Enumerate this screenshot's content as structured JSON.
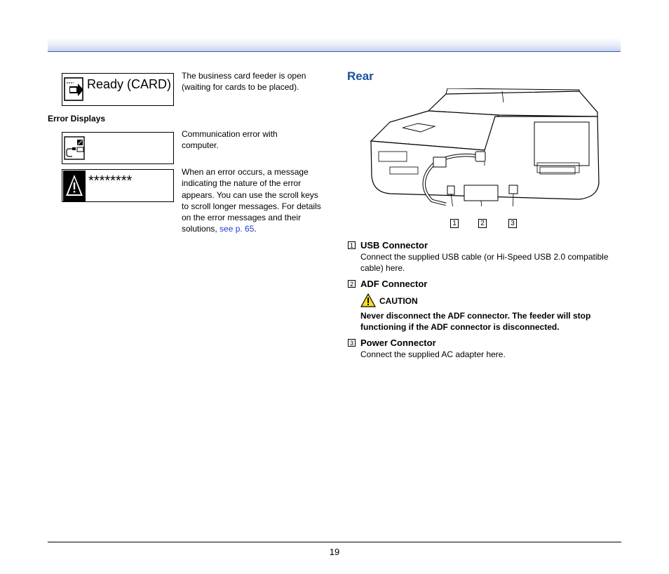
{
  "ready_card": {
    "lcd_text": "Ready (CARD)",
    "description": "The business card feeder is open (waiting for cards to be placed)."
  },
  "error_displays": {
    "heading": "Error Displays",
    "comm_error": {
      "description": "Communication error with computer."
    },
    "error_message": {
      "lcd_text": "********",
      "description": "When an error occurs, a message indicating the nature of the error appears. You can use the scroll keys to scroll longer messages. For details on the error messages and their solutions, ",
      "link_text": "see p. 65",
      "trailing": "."
    }
  },
  "rear": {
    "title": "Rear",
    "callouts": [
      "1",
      "2",
      "3"
    ],
    "items": [
      {
        "num": "1",
        "title": "USB Connector",
        "text": "Connect the supplied USB cable (or Hi-Speed USB 2.0 compatible cable) here."
      },
      {
        "num": "2",
        "title": "ADF Connector"
      },
      {
        "num": "3",
        "title": "Power Connector",
        "text": "Connect the supplied AC adapter here."
      }
    ],
    "caution": {
      "label": "CAUTION",
      "text": "Never disconnect the ADF connector. The feeder will stop functioning if the ADF connector is disconnected."
    }
  },
  "footer": {
    "page_number": "19"
  },
  "colors": {
    "header_rule": "#3a5bb0",
    "section_title": "#1a4fa0",
    "link": "#1f3fd6"
  }
}
